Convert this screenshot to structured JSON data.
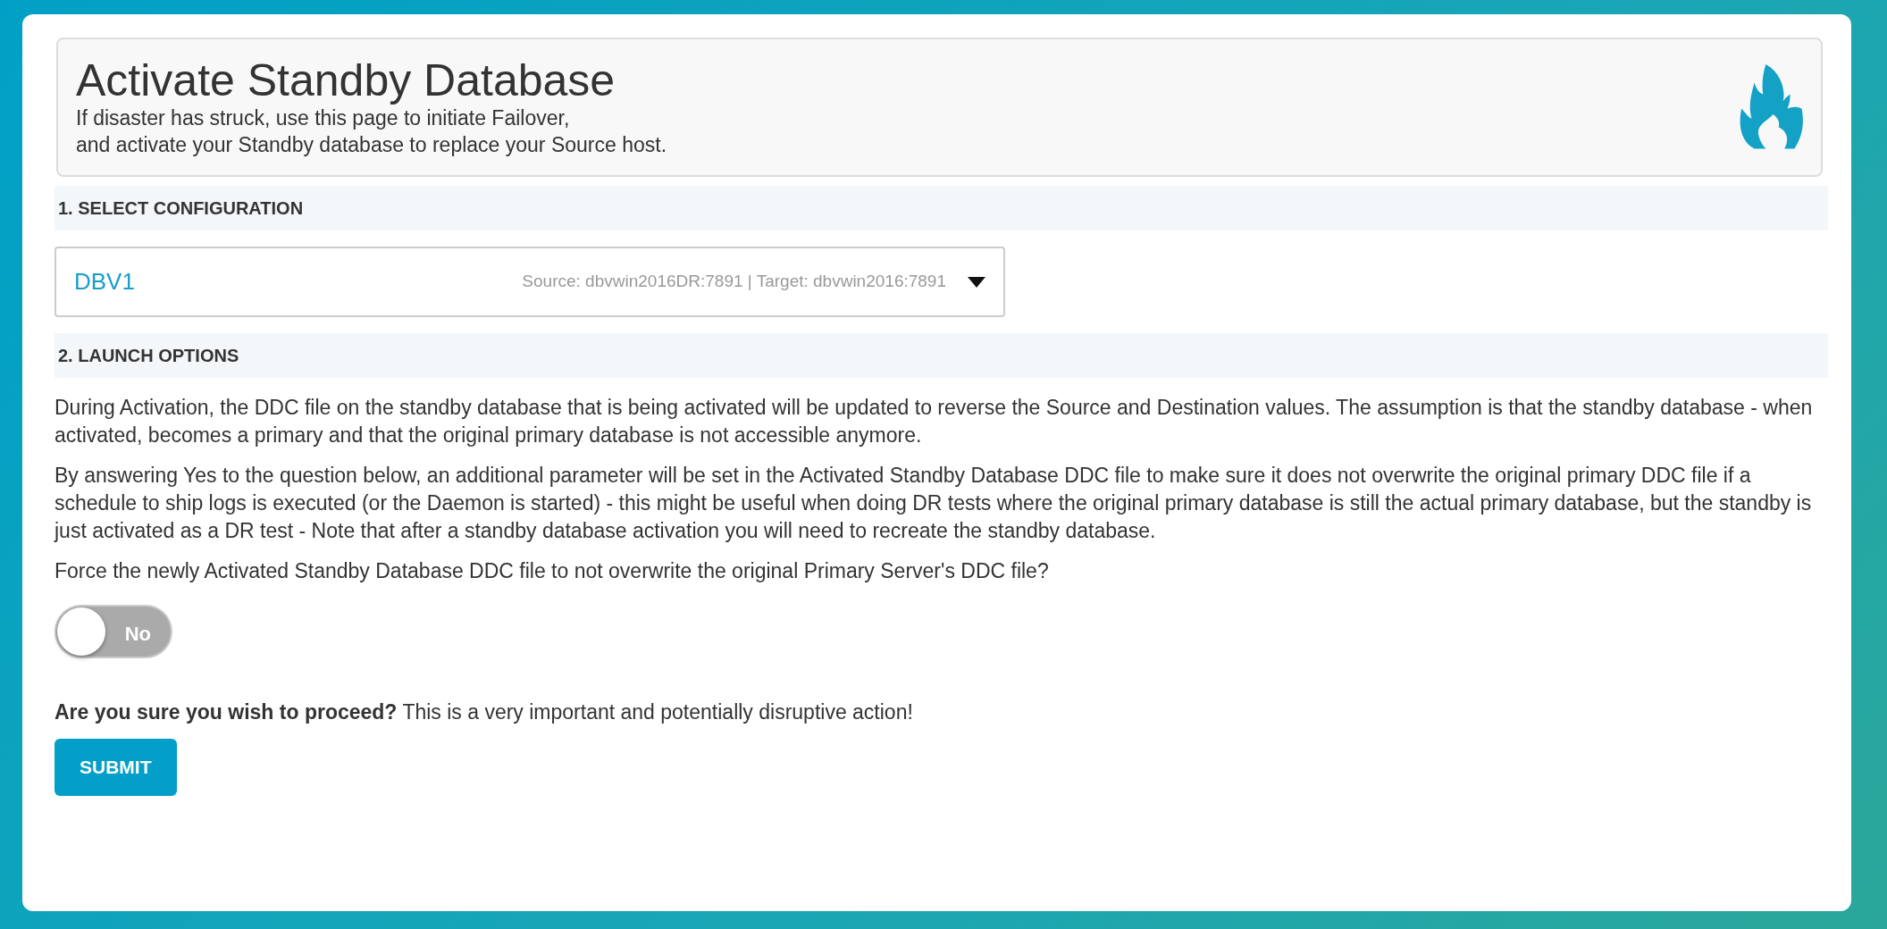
{
  "header": {
    "title": "Activate Standby Database",
    "subtitle_lines": [
      "If disaster has struck, use this page to initiate Failover,",
      "and activate your Standby database to replace your Source host."
    ]
  },
  "sections": [
    {
      "heading": "1. SELECT CONFIGURATION"
    },
    {
      "heading": "2. LAUNCH OPTIONS"
    }
  ],
  "configuration_select": {
    "value": "DBV1",
    "details": "Source: dbvwin2016DR:7891 | Target: dbvwin2016:7891"
  },
  "paragraphs": [
    "During Activation, the DDC file on the standby database that is being activated will be updated to reverse the Source and Destination values. The assumption is that the standby database - when activated, becomes a primary and that the original primary database is not accessible anymore.",
    "By answering Yes to the question below, an additional parameter will be set in the Activated Standby Database DDC file to make sure it does not overwrite the original primary DDC file if a schedule to ship logs is executed (or the Daemon is started) - this might be useful when doing DR tests where the original primary database is still the actual primary database, but the standby is just activated as a DR test - Note that after a standby database activation you will need to recreate the standby database."
  ],
  "question": "Force the newly Activated Standby Database DDC file to not overwrite the original Primary Server's DDC file?",
  "toggle": {
    "label": "No",
    "on": false
  },
  "confirmation": "**Are you sure you wish to proceed?** This is a very important and potentially disruptive action!",
  "submit_button": "SUBMIT"
}
